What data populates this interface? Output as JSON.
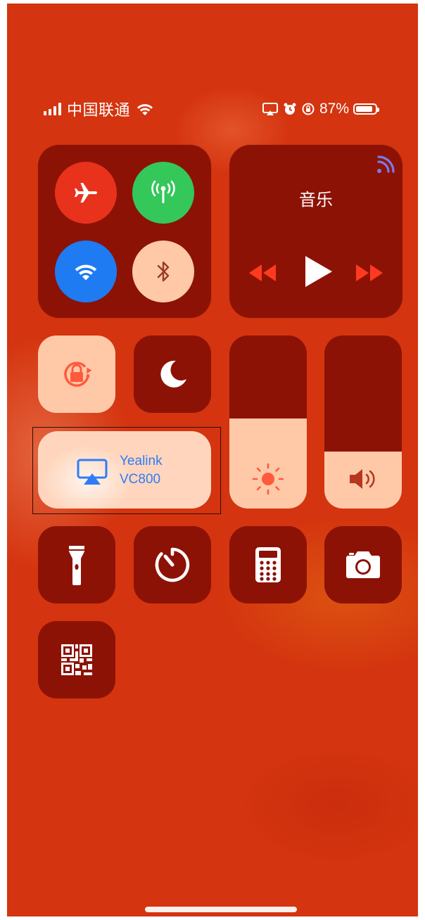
{
  "status_bar": {
    "carrier": "中国联通",
    "battery_percent": "87%",
    "battery_level": 0.87,
    "icons": [
      "signal-icon",
      "wifi-icon",
      "screen-mirroring-icon",
      "alarm-icon",
      "orientation-lock-icon",
      "battery-icon"
    ]
  },
  "connectivity": {
    "airplane": {
      "icon": "airplane-icon",
      "color": "#e8321c"
    },
    "cellular": {
      "icon": "antenna-icon",
      "color": "#34c759"
    },
    "wifi": {
      "icon": "wifi-icon",
      "color": "#1e7bf2"
    },
    "bluetooth": {
      "icon": "bluetooth-icon",
      "color": "#ffc9a8"
    }
  },
  "music": {
    "title": "音乐",
    "controls": [
      "rewind-icon",
      "play-icon",
      "fast-forward-icon"
    ],
    "airplay_icon": "airplay-audio-icon"
  },
  "controls": {
    "orientation_lock": "orientation-lock-icon",
    "do_not_disturb": "moon-icon",
    "flashlight": "flashlight-icon",
    "timer": "timer-icon",
    "calculator": "calculator-icon",
    "camera": "camera-icon",
    "qr_scanner": "qr-code-icon"
  },
  "screen_mirroring": {
    "device_line1": "Yealink",
    "device_line2": "VC800"
  },
  "brightness": {
    "level": 0.52,
    "icon": "sun-icon"
  },
  "volume": {
    "level": 0.33,
    "icon": "speaker-icon"
  },
  "colors": {
    "background": "#d4340f",
    "tile": "#8d1206",
    "tile_active": "#ffc9a8",
    "accent_blue": "#2f7cf6"
  }
}
